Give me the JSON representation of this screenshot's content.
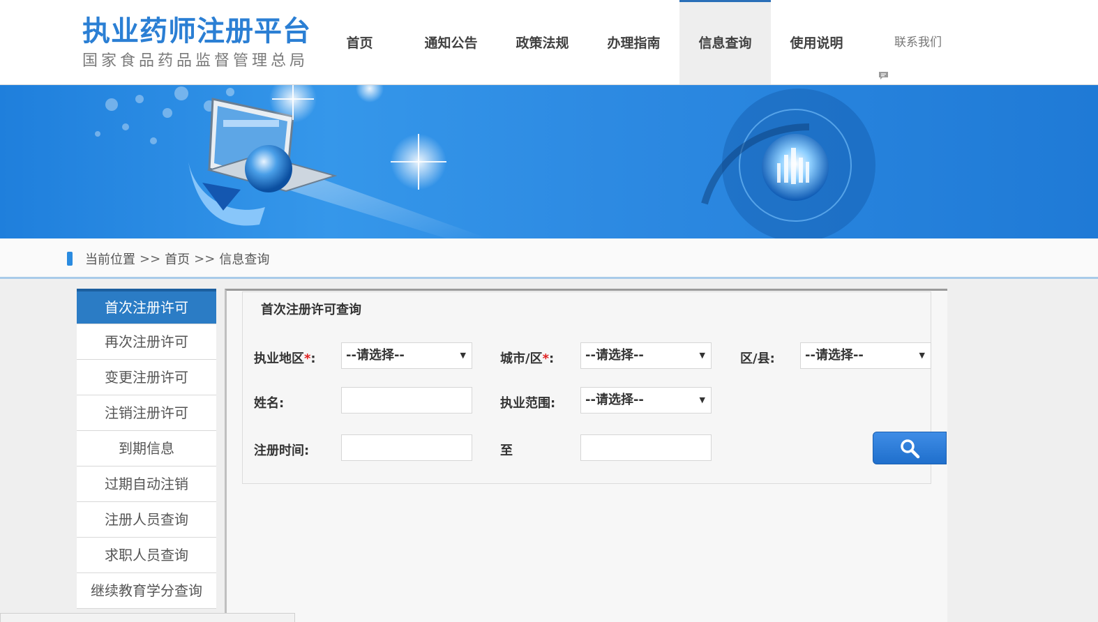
{
  "site": {
    "title": "执业药师注册平台",
    "subtitle": "国家食品药品监督管理总局"
  },
  "nav": {
    "items": [
      {
        "label": "首页"
      },
      {
        "label": "通知公告"
      },
      {
        "label": "政策法规"
      },
      {
        "label": "办理指南"
      },
      {
        "label": "信息查询",
        "active": true
      },
      {
        "label": "使用说明"
      }
    ],
    "contact": "联系我们"
  },
  "breadcrumb": {
    "prefix": "当前位置",
    "sep": ">>",
    "home": "首页",
    "current": "信息查询"
  },
  "sidebar": {
    "items": [
      {
        "label": "首次注册许可",
        "active": true
      },
      {
        "label": "再次注册许可"
      },
      {
        "label": "变更注册许可"
      },
      {
        "label": "注销注册许可"
      },
      {
        "label": "到期信息"
      },
      {
        "label": "过期自动注销"
      },
      {
        "label": "注册人员查询"
      },
      {
        "label": "求职人员查询"
      },
      {
        "label": "继续教育学分查询"
      }
    ]
  },
  "form": {
    "title": "首次注册许可查询",
    "region_label": "执业地区",
    "city_label": "城市/区",
    "county_label": "区/县:",
    "name_label": "姓名:",
    "scope_label": "执业范围:",
    "date_label": "注册时间:",
    "to_label": "至",
    "colon": ":",
    "required_mark": "*",
    "select_placeholder": "--请选择--",
    "name_value": "",
    "date_from_value": "",
    "date_to_value": ""
  },
  "colors": {
    "brand": "#2b7fd4",
    "active_sidebar": "#2b7cc5",
    "required": "#e02020"
  },
  "icons": {
    "contact": "speech-bubble-icon",
    "search": "magnifier-icon",
    "dropdown": "triangle-down-icon"
  }
}
